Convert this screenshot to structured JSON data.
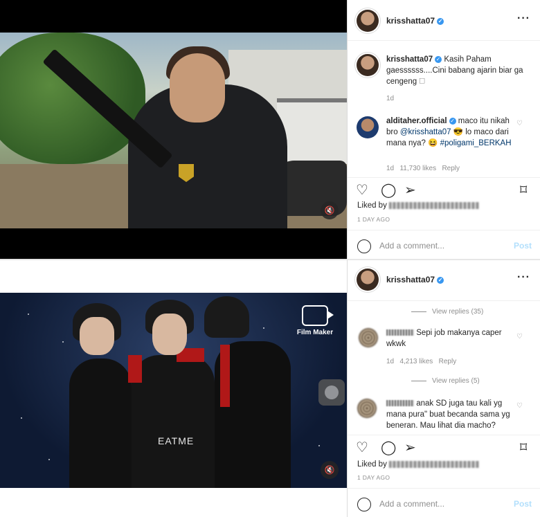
{
  "post1": {
    "username": "krisshatta07",
    "more_icon": "more-options-icon",
    "caption": "Kasih Paham gaessssss....Cini babang ajarin biar ga cengeng 🗆",
    "caption_age": "1d",
    "comment": {
      "username": "alditaher.official",
      "text_a": "maco itu nikah bro ",
      "mention": "@krisshatta07",
      "text_b": " 😎 lo maco dari mana nya? 😆 ",
      "hashtag": "#poligami_BERKAH",
      "age": "1d",
      "likes": "11,730 likes",
      "reply": "Reply"
    },
    "liked_by_label": "Liked by",
    "posted_ago": "1 DAY AGO",
    "add_comment_placeholder": "Add a comment...",
    "post_button": "Post"
  },
  "post2": {
    "username": "krisshatta07",
    "video_watermark": "Film Maker",
    "shirt_text": "EATME",
    "view_replies_1": "View replies (35)",
    "comment1": {
      "text": "Sepi job makanya caper wkwk",
      "age": "1d",
      "likes": "4,213 likes",
      "reply": "Reply"
    },
    "view_replies_2": "View replies (5)",
    "comment2": {
      "text": "anak SD juga tau kali yg mana pura\" buat becanda sama yg beneran. Mau lihat dia macho?"
    },
    "liked_by_label": "Liked by",
    "posted_ago": "1 DAY AGO",
    "add_comment_placeholder": "Add a comment...",
    "post_button": "Post"
  },
  "colors": {
    "verified": "#3897f0",
    "link": "#00376b",
    "muted": "#8e8e8e",
    "post_disabled": "#b2dffc"
  }
}
